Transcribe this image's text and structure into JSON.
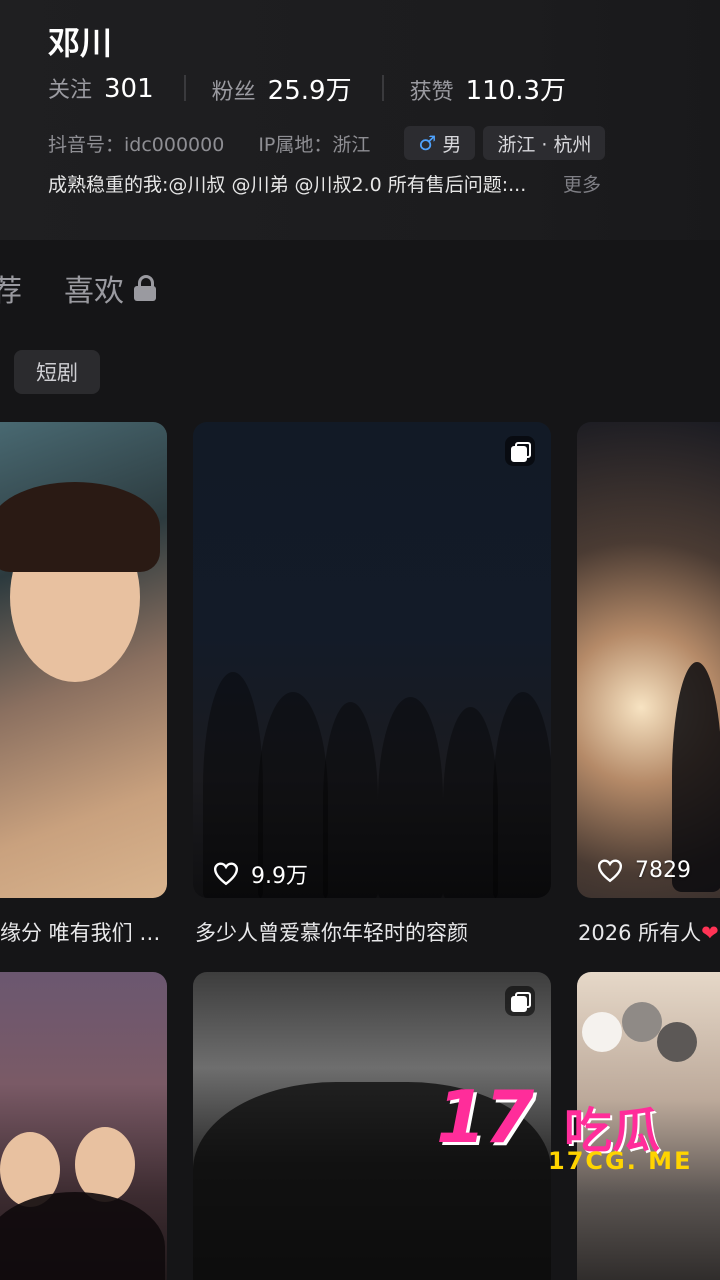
{
  "profile": {
    "name": "邓川",
    "stats": [
      {
        "label": "关注",
        "value": "301"
      },
      {
        "label": "粉丝",
        "value": "25.9万"
      },
      {
        "label": "获赞",
        "value": "110.3万"
      }
    ],
    "douyin_id": "抖音号：idc000000",
    "ip_location": "IP属地：浙江",
    "gender_tag": "男",
    "region_tag": "浙江 · 杭州",
    "bio": "成熟稳重的我:@川叔  @川弟  @川叔2.0  所有售后问题:...",
    "more_label": "更多"
  },
  "tabs": {
    "partial_label": "荐",
    "likes_label": "喜欢"
  },
  "filter_chip": "短剧",
  "videos": [
    {
      "caption": "缘分 唯有我们 …",
      "likes": ""
    },
    {
      "caption": "多少人曾爱慕你年轻时的容颜",
      "likes": "9.9万",
      "multi_image": true
    },
    {
      "caption": "2026 所有人",
      "likes": "7829"
    },
    {
      "caption": "",
      "likes": ""
    },
    {
      "caption": "",
      "likes": "",
      "multi_image": true
    },
    {
      "caption": "",
      "likes": ""
    }
  ],
  "watermark": {
    "number": "17",
    "chinese": "吃瓜",
    "url": "17CG. ME"
  },
  "colors": {
    "background": "#151517",
    "gender_accent": "#4fa3ff",
    "watermark_pink": "#ff2d9a",
    "watermark_yellow": "#ffd400",
    "caption_heart": "#ff3355"
  }
}
